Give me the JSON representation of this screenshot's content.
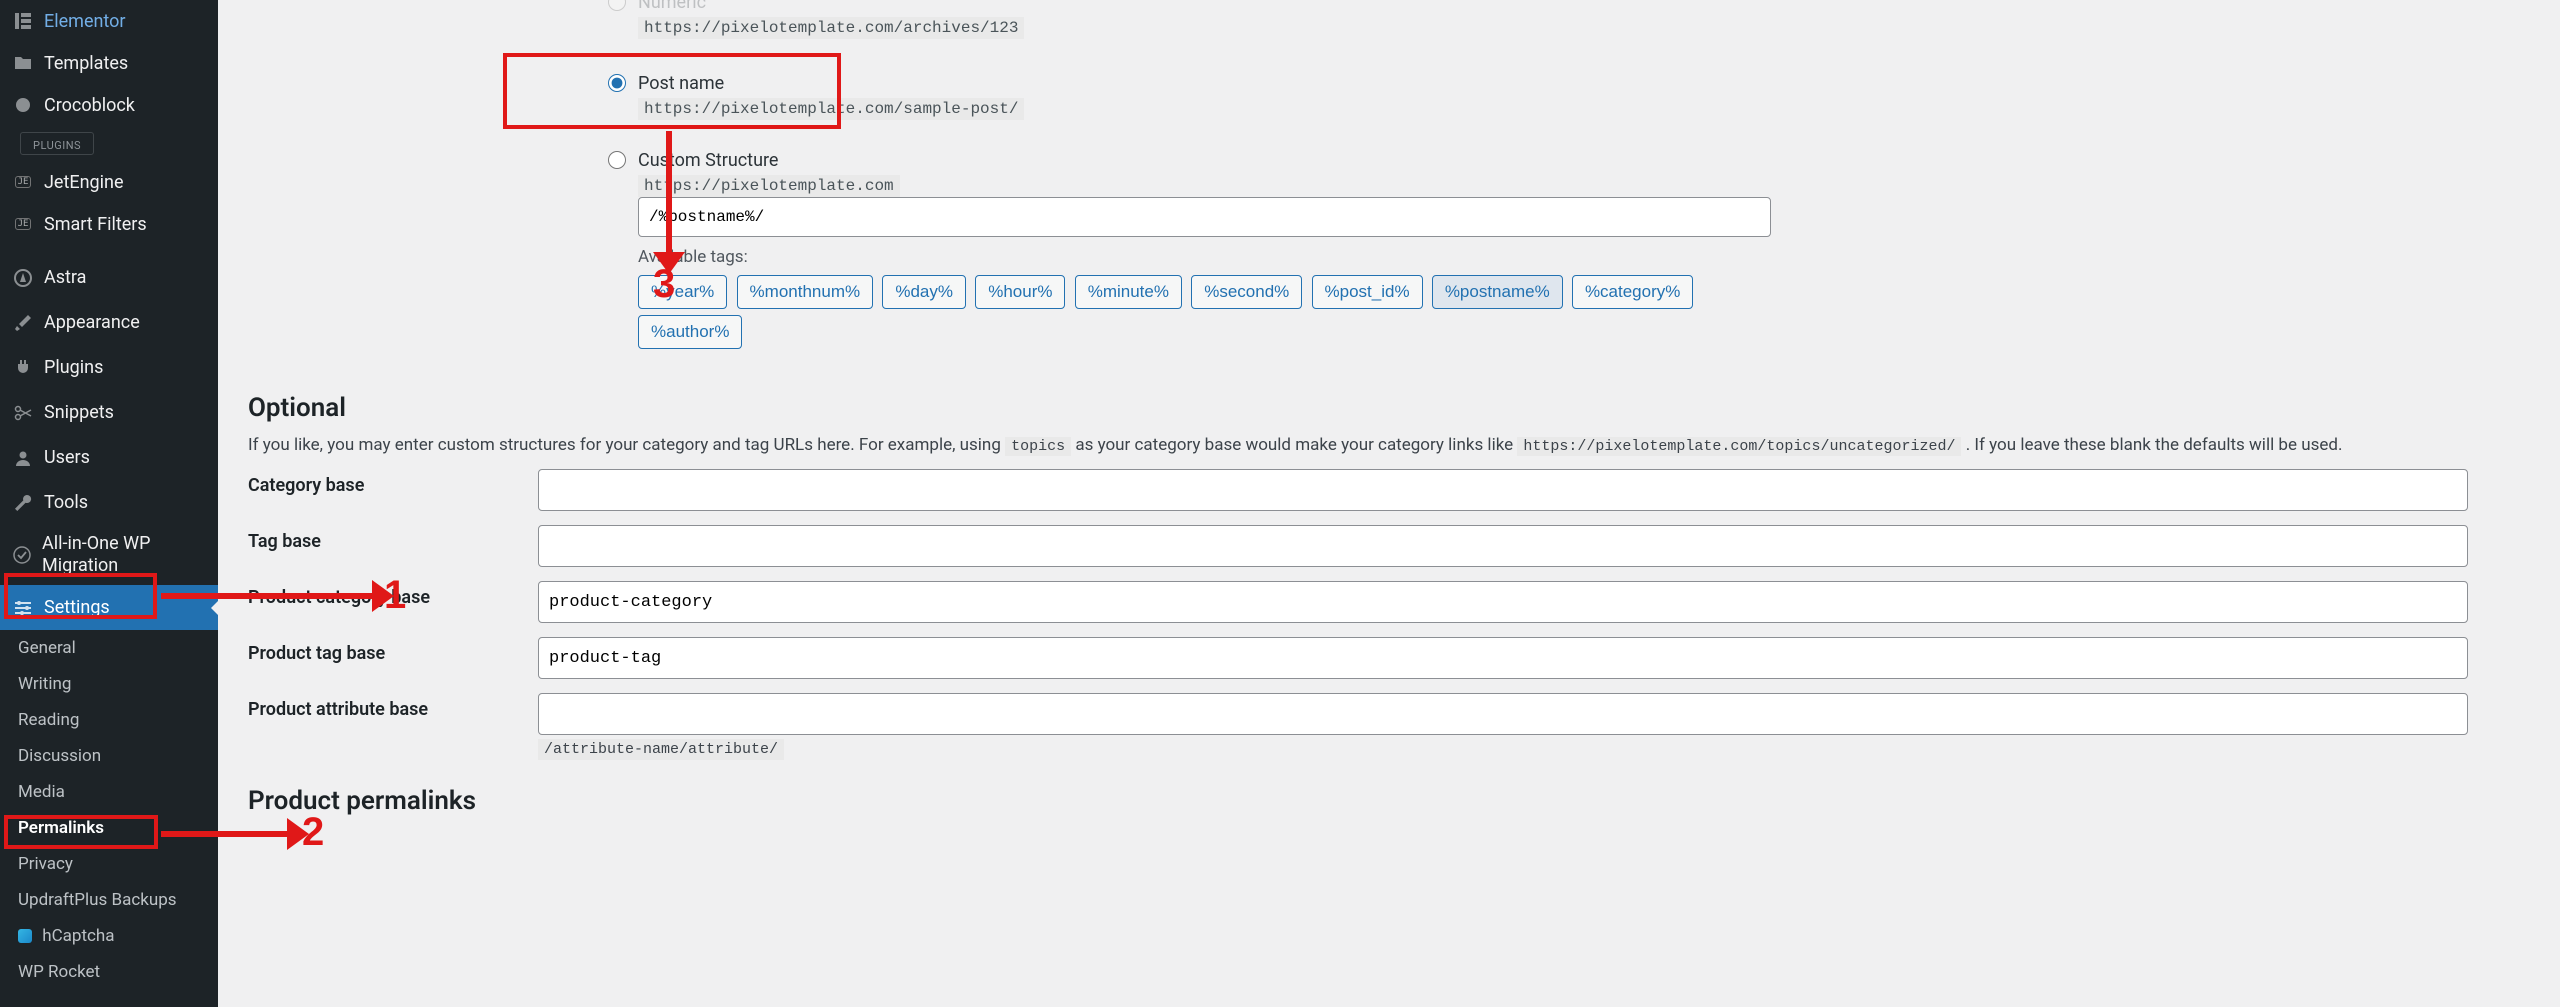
{
  "sidebar": {
    "items": [
      {
        "label": "Elementor"
      },
      {
        "label": "Templates"
      },
      {
        "label": "Crocoblock"
      },
      {
        "label": "JetEngine"
      },
      {
        "label": "Smart Filters"
      },
      {
        "label": "Astra"
      },
      {
        "label": "Appearance"
      },
      {
        "label": "Plugins"
      },
      {
        "label": "Snippets"
      },
      {
        "label": "Users"
      },
      {
        "label": "Tools"
      },
      {
        "label": "All-in-One WP Migration"
      },
      {
        "label": "Settings"
      }
    ],
    "plugins_sep": "PLUGINS",
    "settings_submenu": [
      "General",
      "Writing",
      "Reading",
      "Discussion",
      "Media",
      "Permalinks",
      "Privacy",
      "UpdraftPlus Backups",
      "hCaptcha",
      "WP Rocket"
    ]
  },
  "permalinks": {
    "numeric_label": "Numeric",
    "numeric_url": "https://pixelotemplate.com/archives/123",
    "postname_label": "Post name",
    "postname_url": "https://pixelotemplate.com/sample-post/",
    "custom_label": "Custom Structure",
    "custom_prefix": "https://pixelotemplate.com",
    "custom_value": "/%postname%/",
    "available_tags_label": "Available tags:",
    "tags": [
      "%year%",
      "%monthnum%",
      "%day%",
      "%hour%",
      "%minute%",
      "%second%",
      "%post_id%",
      "%postname%",
      "%category%",
      "%author%"
    ]
  },
  "optional": {
    "title": "Optional",
    "desc_1": "If you like, you may enter custom structures for your category and tag URLs here. For example, using ",
    "code_1": "topics",
    "desc_2": " as your category base would make your category links like ",
    "code_2": "https://pixelotemplate.com/topics/uncategorized/",
    "desc_3": " . If you leave these blank the defaults will be used.",
    "rows": {
      "category_base": {
        "label": "Category base",
        "value": ""
      },
      "tag_base": {
        "label": "Tag base",
        "value": ""
      },
      "product_category_base": {
        "label": "Product category base",
        "value": "product-category"
      },
      "product_tag_base": {
        "label": "Product tag base",
        "value": "product-tag"
      },
      "product_attribute_base": {
        "label": "Product attribute base",
        "value": "",
        "hint": "/attribute-name/attribute/"
      }
    }
  },
  "product_permalinks_title": "Product permalinks",
  "annotations": {
    "n1": "1",
    "n2": "2",
    "n3": "3"
  }
}
